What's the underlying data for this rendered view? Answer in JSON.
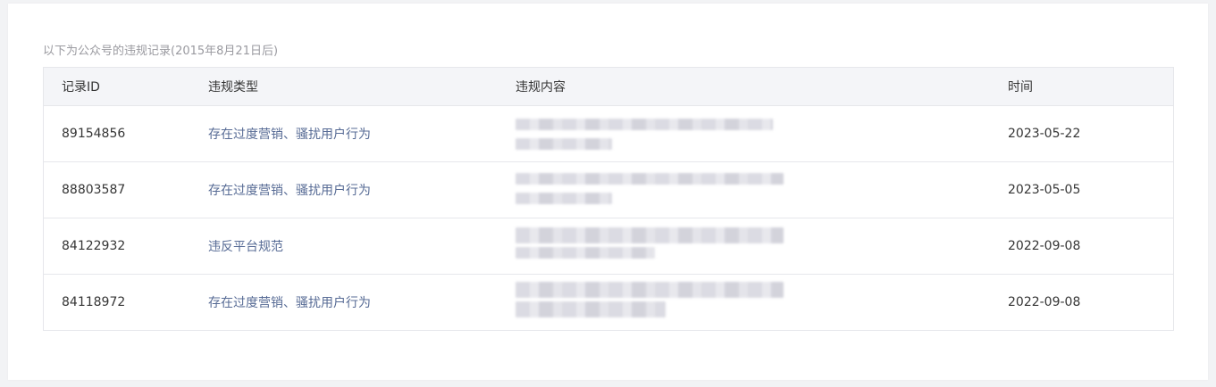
{
  "intro_text": "以下为公众号的违规记录(2015年8月21日后)",
  "table": {
    "headers": {
      "id": "记录ID",
      "type": "违规类型",
      "content": "违规内容",
      "time": "时间"
    },
    "rows": [
      {
        "id": "89154856",
        "type": "存在过度营销、骚扰用户行为",
        "time": "2023-05-22"
      },
      {
        "id": "88803587",
        "type": "存在过度营销、骚扰用户行为",
        "time": "2023-05-05"
      },
      {
        "id": "84122932",
        "type": "违反平台规范",
        "time": "2022-09-08"
      },
      {
        "id": "84118972",
        "type": "存在过度营销、骚扰用户行为",
        "time": "2022-09-08"
      }
    ]
  },
  "colors": {
    "link": "#576b95",
    "header_bg": "#f4f5f8",
    "border": "#e6e7eb",
    "muted_text": "#9a9aa0"
  }
}
